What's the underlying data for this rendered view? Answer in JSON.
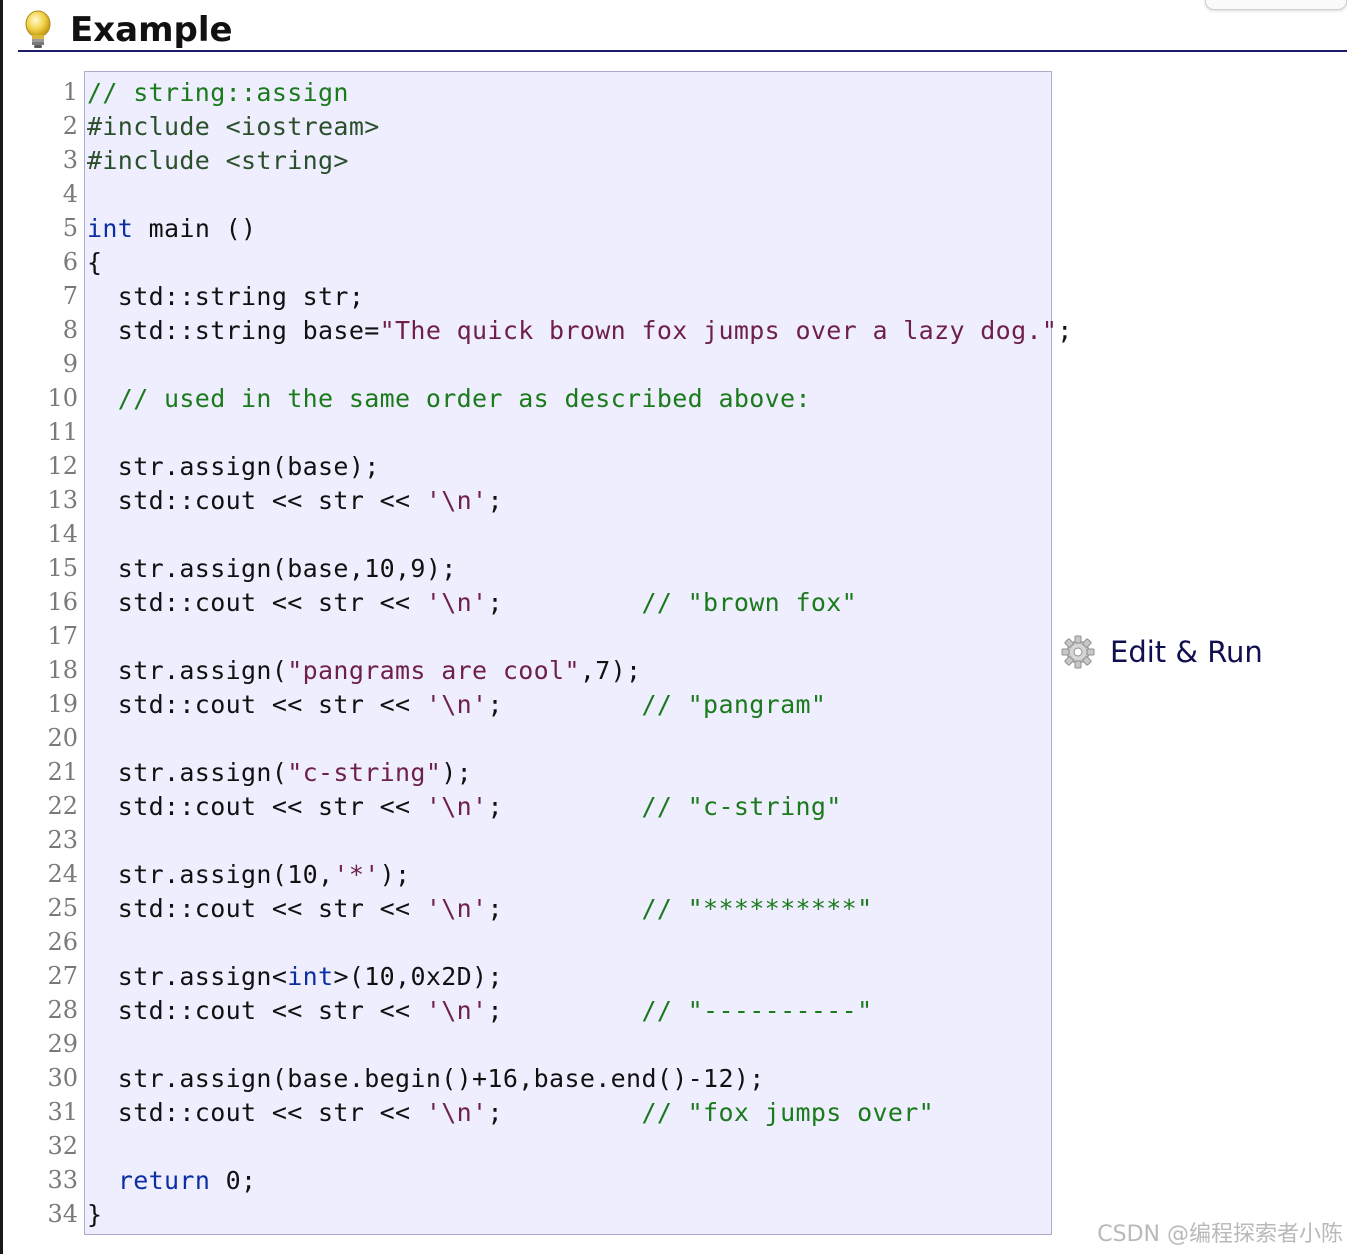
{
  "header": {
    "title": "Example",
    "icon": "lightbulb-icon"
  },
  "code": {
    "line_numbers": [
      "1",
      "2",
      "3",
      "4",
      "5",
      "6",
      "7",
      "8",
      "9",
      "10",
      "11",
      "12",
      "13",
      "14",
      "15",
      "16",
      "17",
      "18",
      "19",
      "20",
      "21",
      "22",
      "23",
      "24",
      "25",
      "26",
      "27",
      "28",
      "29",
      "30",
      "31",
      "32",
      "33",
      "34"
    ],
    "lines": [
      [
        {
          "t": "com",
          "v": "// string::assign"
        }
      ],
      [
        {
          "t": "pre",
          "v": "#include <iostream>"
        }
      ],
      [
        {
          "t": "pre",
          "v": "#include <string>"
        }
      ],
      [],
      [
        {
          "t": "kw",
          "v": "int"
        },
        {
          "t": "",
          "v": " main ()"
        }
      ],
      [
        {
          "t": "",
          "v": "{"
        }
      ],
      [
        {
          "t": "",
          "v": "  std::string str;"
        }
      ],
      [
        {
          "t": "",
          "v": "  std::string base="
        },
        {
          "t": "str",
          "v": "\"The quick brown fox jumps over a lazy dog.\""
        },
        {
          "t": "",
          "v": ";"
        }
      ],
      [],
      [
        {
          "t": "com",
          "v": "  // used in the same order as described above:"
        }
      ],
      [],
      [
        {
          "t": "",
          "v": "  str.assign(base);"
        }
      ],
      [
        {
          "t": "",
          "v": "  std::cout << str << "
        },
        {
          "t": "chr",
          "v": "'\\n'"
        },
        {
          "t": "",
          "v": ";"
        }
      ],
      [],
      [
        {
          "t": "",
          "v": "  str.assign(base,10,9);"
        }
      ],
      [
        {
          "t": "",
          "v": "  std::cout << str << "
        },
        {
          "t": "chr",
          "v": "'\\n'"
        },
        {
          "t": "",
          "v": ";         "
        },
        {
          "t": "com",
          "v": "// \"brown fox\""
        }
      ],
      [],
      [
        {
          "t": "",
          "v": "  str.assign("
        },
        {
          "t": "str",
          "v": "\"pangrams are cool\""
        },
        {
          "t": "",
          "v": ",7);"
        }
      ],
      [
        {
          "t": "",
          "v": "  std::cout << str << "
        },
        {
          "t": "chr",
          "v": "'\\n'"
        },
        {
          "t": "",
          "v": ";         "
        },
        {
          "t": "com",
          "v": "// \"pangram\""
        }
      ],
      [],
      [
        {
          "t": "",
          "v": "  str.assign("
        },
        {
          "t": "str",
          "v": "\"c-string\""
        },
        {
          "t": "",
          "v": ");"
        }
      ],
      [
        {
          "t": "",
          "v": "  std::cout << str << "
        },
        {
          "t": "chr",
          "v": "'\\n'"
        },
        {
          "t": "",
          "v": ";         "
        },
        {
          "t": "com",
          "v": "// \"c-string\""
        }
      ],
      [],
      [
        {
          "t": "",
          "v": "  str.assign(10,"
        },
        {
          "t": "chr",
          "v": "'*'"
        },
        {
          "t": "",
          "v": ");"
        }
      ],
      [
        {
          "t": "",
          "v": "  std::cout << str << "
        },
        {
          "t": "chr",
          "v": "'\\n'"
        },
        {
          "t": "",
          "v": ";         "
        },
        {
          "t": "com",
          "v": "// \"**********\""
        }
      ],
      [],
      [
        {
          "t": "",
          "v": "  str.assign<"
        },
        {
          "t": "kw",
          "v": "int"
        },
        {
          "t": "",
          "v": ">(10,0x2D);"
        }
      ],
      [
        {
          "t": "",
          "v": "  std::cout << str << "
        },
        {
          "t": "chr",
          "v": "'\\n'"
        },
        {
          "t": "",
          "v": ";         "
        },
        {
          "t": "com",
          "v": "// \"----------\""
        }
      ],
      [],
      [
        {
          "t": "",
          "v": "  str.assign(base.begin()+16,base.end()-12);"
        }
      ],
      [
        {
          "t": "",
          "v": "  std::cout << str << "
        },
        {
          "t": "chr",
          "v": "'\\n'"
        },
        {
          "t": "",
          "v": ";         "
        },
        {
          "t": "com",
          "v": "// \"fox jumps over\""
        }
      ],
      [],
      [
        {
          "t": "",
          "v": "  "
        },
        {
          "t": "kw",
          "v": "return"
        },
        {
          "t": "",
          "v": " 0;"
        }
      ],
      [
        {
          "t": "",
          "v": "}"
        }
      ]
    ]
  },
  "actions": {
    "edit_run_label": "Edit & Run",
    "edit_run_icon": "gear-icon"
  },
  "watermark": {
    "text": "CSDN @编程探索者小陈"
  },
  "colors": {
    "code_background": "#eeeeff",
    "comment": "#1b7a1b",
    "keyword": "#0b2fa0",
    "string": "#6e1f4a",
    "header_rule": "#1c1c6b"
  }
}
